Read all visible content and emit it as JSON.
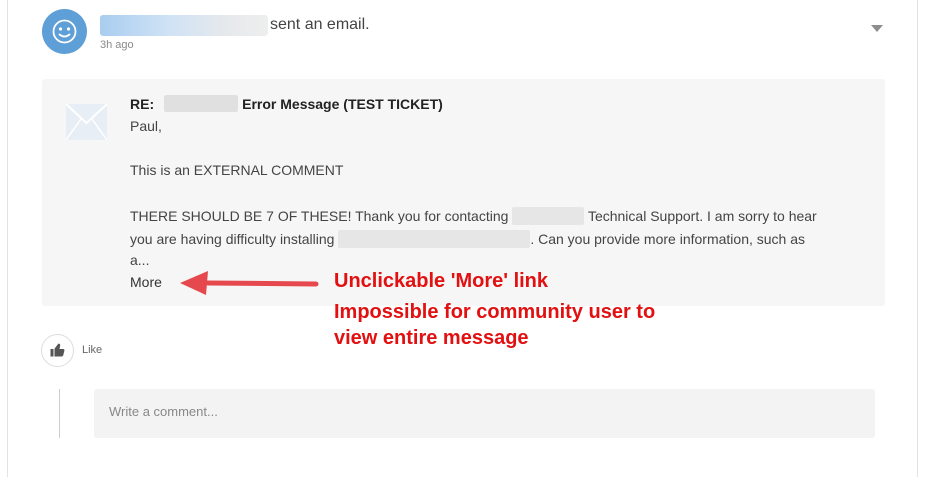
{
  "post": {
    "action_text": "sent an email.",
    "timestamp": "3h ago"
  },
  "email": {
    "subject_prefix": "RE:",
    "subject_rest": "Error Message (TEST TICKET)",
    "greeting": "Paul,",
    "line_comment": "This is an EXTERNAL COMMENT",
    "line1_start": "THERE SHOULD BE 7 OF THESE! Thank you for contacting",
    "line1_end": "Technical Support. I am sorry to hear",
    "line2_start": "you are having difficulty installing",
    "line2_end": ". Can you provide more information, such as",
    "line3": "a...",
    "more_label": "More"
  },
  "annotations": {
    "line1": "Unclickable 'More' link",
    "line2": "Impossible for community user to",
    "line3": "view entire message",
    "color": "#e21010"
  },
  "actions": {
    "like_label": "Like"
  },
  "comment": {
    "placeholder": "Write a comment..."
  },
  "icons": {
    "avatar": "smiley-face-icon",
    "envelope": "envelope-icon",
    "caret": "caret-down-icon",
    "like": "thumbs-up-icon"
  }
}
